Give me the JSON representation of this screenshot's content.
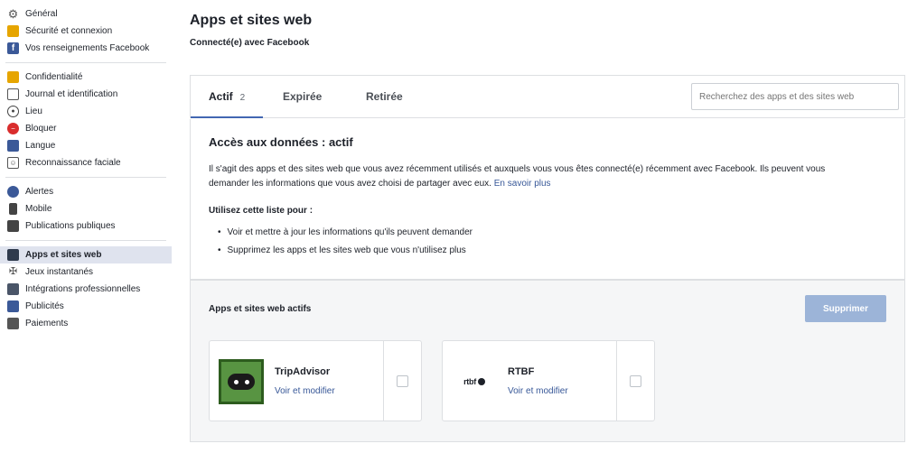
{
  "sidebar": {
    "items": [
      {
        "label": "Général",
        "icon": "gear-icon"
      },
      {
        "label": "Sécurité et connexion",
        "icon": "lock-icon"
      },
      {
        "label": "Vos renseignements Facebook",
        "icon": "facebook-icon"
      },
      {
        "label": "Confidentialité",
        "icon": "privacy-icon"
      },
      {
        "label": "Journal et identification",
        "icon": "journal-icon"
      },
      {
        "label": "Lieu",
        "icon": "location-icon"
      },
      {
        "label": "Bloquer",
        "icon": "block-icon"
      },
      {
        "label": "Langue",
        "icon": "language-icon"
      },
      {
        "label": "Reconnaissance faciale",
        "icon": "face-recognition-icon"
      },
      {
        "label": "Alertes",
        "icon": "alerts-icon"
      },
      {
        "label": "Mobile",
        "icon": "mobile-icon"
      },
      {
        "label": "Publications publiques",
        "icon": "public-posts-icon"
      },
      {
        "label": "Apps et sites web",
        "icon": "apps-icon"
      },
      {
        "label": "Jeux instantanés",
        "icon": "games-icon"
      },
      {
        "label": "Intégrations professionnelles",
        "icon": "integrations-icon"
      },
      {
        "label": "Publicités",
        "icon": "ads-icon"
      },
      {
        "label": "Paiements",
        "icon": "payments-icon"
      }
    ],
    "active_item": "Apps et sites web"
  },
  "header": {
    "title": "Apps et sites web",
    "subtitle": "Connecté(e) avec Facebook"
  },
  "tabs": [
    {
      "label": "Actif",
      "count": "2"
    },
    {
      "label": "Expirée",
      "count": ""
    },
    {
      "label": "Retirée",
      "count": ""
    }
  ],
  "search": {
    "placeholder": "Recherchez des apps et des sites web"
  },
  "access": {
    "title": "Accès aux données : actif",
    "description": "Il s'agit des apps et des sites web que vous avez récemment utilisés et auxquels vous vous êtes connecté(e) récemment avec Facebook. Ils peuvent vous demander les informations que vous avez choisi de partager avec eux.",
    "learn_more": "En savoir plus",
    "use_title": "Utilisez cette liste pour :",
    "bullets": [
      "Voir et mettre à jour les informations qu'ils peuvent demander",
      "Supprimez les apps et les sites web que vous n'utilisez plus"
    ]
  },
  "active_apps": {
    "title": "Apps et sites web actifs",
    "delete_label": "Supprimer",
    "apps": [
      {
        "name": "TripAdvisor",
        "edit_label": "Voir et modifier",
        "logo": "tripadvisor-logo"
      },
      {
        "name": "RTBF",
        "edit_label": "Voir et modifier",
        "logo": "rtbf-logo",
        "logo_text": "rtbf"
      }
    ]
  },
  "colors": {
    "accent": "#4267b2",
    "link": "#385898",
    "button_disabled": "#9cb4d8",
    "active_sidebar_bg": "#dfe3ee"
  }
}
